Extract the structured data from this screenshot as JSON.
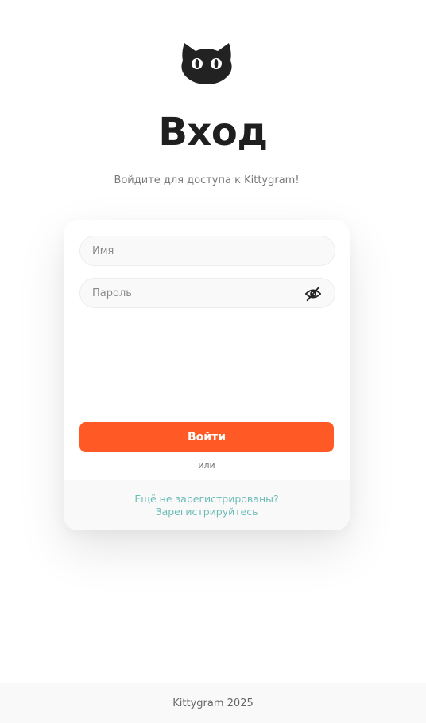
{
  "logo": {
    "icon": "cat-head-icon",
    "color": "#222222"
  },
  "header": {
    "title": "Вход",
    "subtitle": "Войдите для доступа к Kittygram!"
  },
  "form": {
    "name_placeholder": "Имя",
    "name_value": "",
    "password_placeholder": "Пароль",
    "password_value": "",
    "password_toggle_icon": "eye-slash-icon",
    "submit_label": "Войти",
    "separator": "или"
  },
  "register": {
    "line1": "Ещё не зарегистрированы?",
    "line2": "Зарегистрируйтесь"
  },
  "footer": {
    "text": "Kittygram 2025"
  },
  "colors": {
    "accent": "#ff5a25",
    "link": "#6cbcb6",
    "field_bg": "#f9f9f9"
  }
}
